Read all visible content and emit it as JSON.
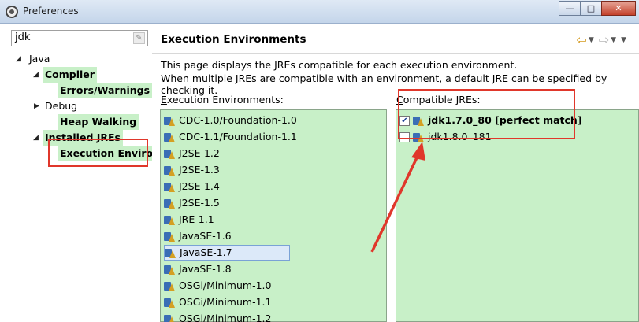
{
  "window": {
    "title": "Preferences",
    "minimize_label": "—",
    "maximize_label": "□",
    "close_label": "✕"
  },
  "filter": {
    "value": "jdk"
  },
  "tree": {
    "java": "Java",
    "compiler": "Compiler",
    "errors_warnings": "Errors/Warnings",
    "debug": "Debug",
    "heap_walking": "Heap Walking",
    "installed_jres": "Installed JREs",
    "execution_env": "Execution Enviro"
  },
  "page": {
    "title": "Execution Environments",
    "desc_line1": "This page displays the JREs compatible for each execution environment.",
    "desc_line2": "When multiple JREs are compatible with an environment, a default JRE can be specified by checking it.",
    "env_label": "Execution Environments:",
    "jre_label": "Compatible JREs:"
  },
  "environments": [
    "CDC-1.0/Foundation-1.0",
    "CDC-1.1/Foundation-1.1",
    "J2SE-1.2",
    "J2SE-1.3",
    "J2SE-1.4",
    "J2SE-1.5",
    "JRE-1.1",
    "JavaSE-1.6",
    "JavaSE-1.7",
    "JavaSE-1.8",
    "OSGi/Minimum-1.0",
    "OSGi/Minimum-1.1",
    "OSGi/Minimum-1.2"
  ],
  "selected_environment": "JavaSE-1.7",
  "compatible_jres": [
    {
      "name": "jdk1.7.0_80 [perfect match]",
      "checked": true
    },
    {
      "name": "jdk1.8.0_181",
      "checked": false
    }
  ],
  "colors": {
    "highlight_green": "#c8f0c8",
    "annotation_red": "#e0372b",
    "selection_blue": "#dce9f9"
  }
}
